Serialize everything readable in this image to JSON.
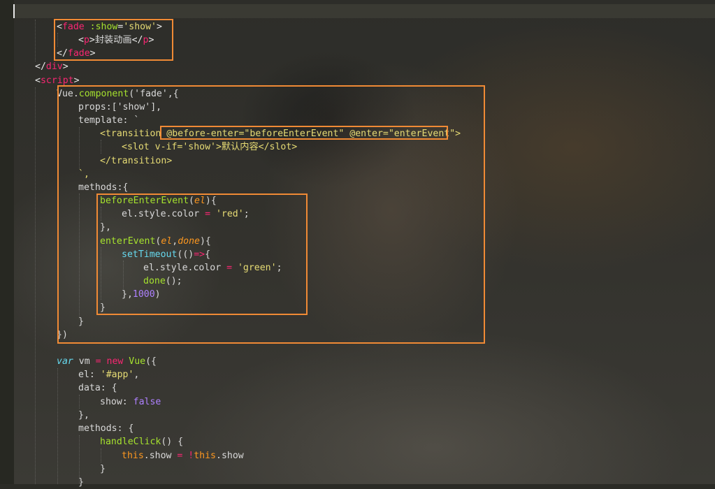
{
  "editor": {
    "lines": {
      "l1_open": "<",
      "l1_tag": "fade",
      "l1_attr": ":show",
      "l1_eq": "=",
      "l1_val": "'show'",
      "l1_close": ">",
      "l2_open": "<",
      "l2_tag": "p",
      "l2_gt": ">",
      "l2_text": "封装动画",
      "l2_lt": "</",
      "l2_tag2": "p",
      "l2_close": ">",
      "l3_open": "</",
      "l3_tag": "fade",
      "l3_close": ">",
      "l4_open": "</",
      "l4_tag": "div",
      "l4_close": ">",
      "l5_open": "<",
      "l5_tag": "script",
      "l5_close": ">",
      "l6_obj": "Vue.",
      "l6_fn": "component",
      "l6_args": "('fade',{",
      "l7_text": "props:['show'],",
      "l8_text": "template: `",
      "l9_a": "<transition ",
      "l9_b": "@before-enter=\"beforeEnterEvent\" @enter=\"enterEvent\"",
      "l9_c": ">",
      "l10_text": "<slot v-if='show'>默认内容</slot>",
      "l11_text": "</transition>",
      "l12_text": "`,",
      "l13_text": "methods:{",
      "l14_fn": "beforeEnterEvent",
      "l14_p1": "(",
      "l14_param": "el",
      "l14_p2": "){",
      "l15_a": "el.style.color ",
      "l15_op": "=",
      "l15_str": " 'red'",
      "l15_end": ";",
      "l16_text": "},",
      "l17_fn": "enterEvent",
      "l17_p1": "(",
      "l17_param1": "el",
      "l17_comma": ",",
      "l17_param2": "done",
      "l17_p2": "){",
      "l18_fn": "setTimeout",
      "l18_a": "(()",
      "l18_op": "=>",
      "l18_b": "{",
      "l19_a": "el.style.color ",
      "l19_op": "=",
      "l19_str": " 'green'",
      "l19_end": ";",
      "l20_fn": "done",
      "l20_rest": "();",
      "l21_a": "},",
      "l21_num": "1000",
      "l21_b": ")",
      "l22_text": "}",
      "l23_text": "}",
      "l24_text": "})",
      "l25_kw": "var",
      "l25_a": " vm ",
      "l25_op": "=",
      "l25_sp": " ",
      "l25_new": "new",
      "l25_sp2": " ",
      "l25_fn": "Vue",
      "l25_b": "({",
      "l26_a": "el: ",
      "l26_str": "'#app'",
      "l26_b": ",",
      "l27_text": "data: {",
      "l28_a": "show: ",
      "l28_bool": "false",
      "l29_text": "},",
      "l30_text": "methods: {",
      "l31_fn": "handleClick",
      "l31_rest": "() {",
      "l32_this1": "this",
      "l32_a": ".show ",
      "l32_op": "= !",
      "l32_this2": "this",
      "l32_b": ".show",
      "l33_text": "}",
      "l34_text": "}"
    }
  },
  "colors": {
    "annotation_border": "#f08a35",
    "tag": "#f92672",
    "attribute": "#a6e22e",
    "string": "#e6db74",
    "keyword": "#66d9ef",
    "number": "#ae81ff",
    "parameter": "#fd971f"
  }
}
